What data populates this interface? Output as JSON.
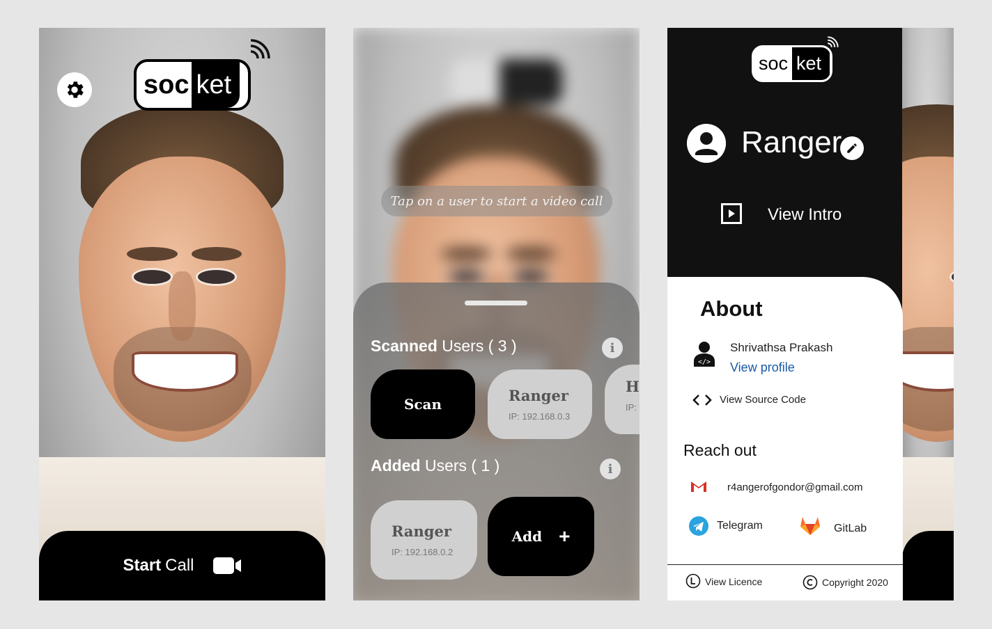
{
  "brand": {
    "logo_left": "soc",
    "logo_right": "ket"
  },
  "home": {
    "start_bold": "Start",
    "start_rest": "Call"
  },
  "scan": {
    "hint": "Tap on a user to start a video call",
    "scanned_bold": "Scanned",
    "scanned_rest": "Users ( 3 )",
    "added_bold": "Added",
    "added_rest": "Users ( 1 )",
    "info_glyph": "i",
    "scan_label": "Scan",
    "scanned_users": [
      {
        "name": "Ranger",
        "ip": "IP: 192.168.0.3"
      },
      {
        "name": "Ho",
        "ip": "IP:"
      }
    ],
    "added_users": [
      {
        "name": "Ranger",
        "ip": "IP: 192.168.0.2"
      }
    ],
    "add_label": "Add",
    "add_glyph": "+"
  },
  "profile": {
    "username": "Ranger",
    "view_intro": "View Intro",
    "about_title": "About",
    "developer": "Shrivathsa Prakash",
    "view_profile": "View profile",
    "source_code": "View Source Code",
    "reach_title": "Reach out",
    "email": "r4angerofgondor@gmail.com",
    "telegram": "Telegram",
    "gitlab": "GitLab",
    "licence": "View Licence",
    "copyright": "Copyright 2020"
  },
  "colors": {
    "link": "#1a5aa6",
    "gmail": "#d93025",
    "telegram": "#2aa3df",
    "gitlab": "#fc6d26"
  }
}
